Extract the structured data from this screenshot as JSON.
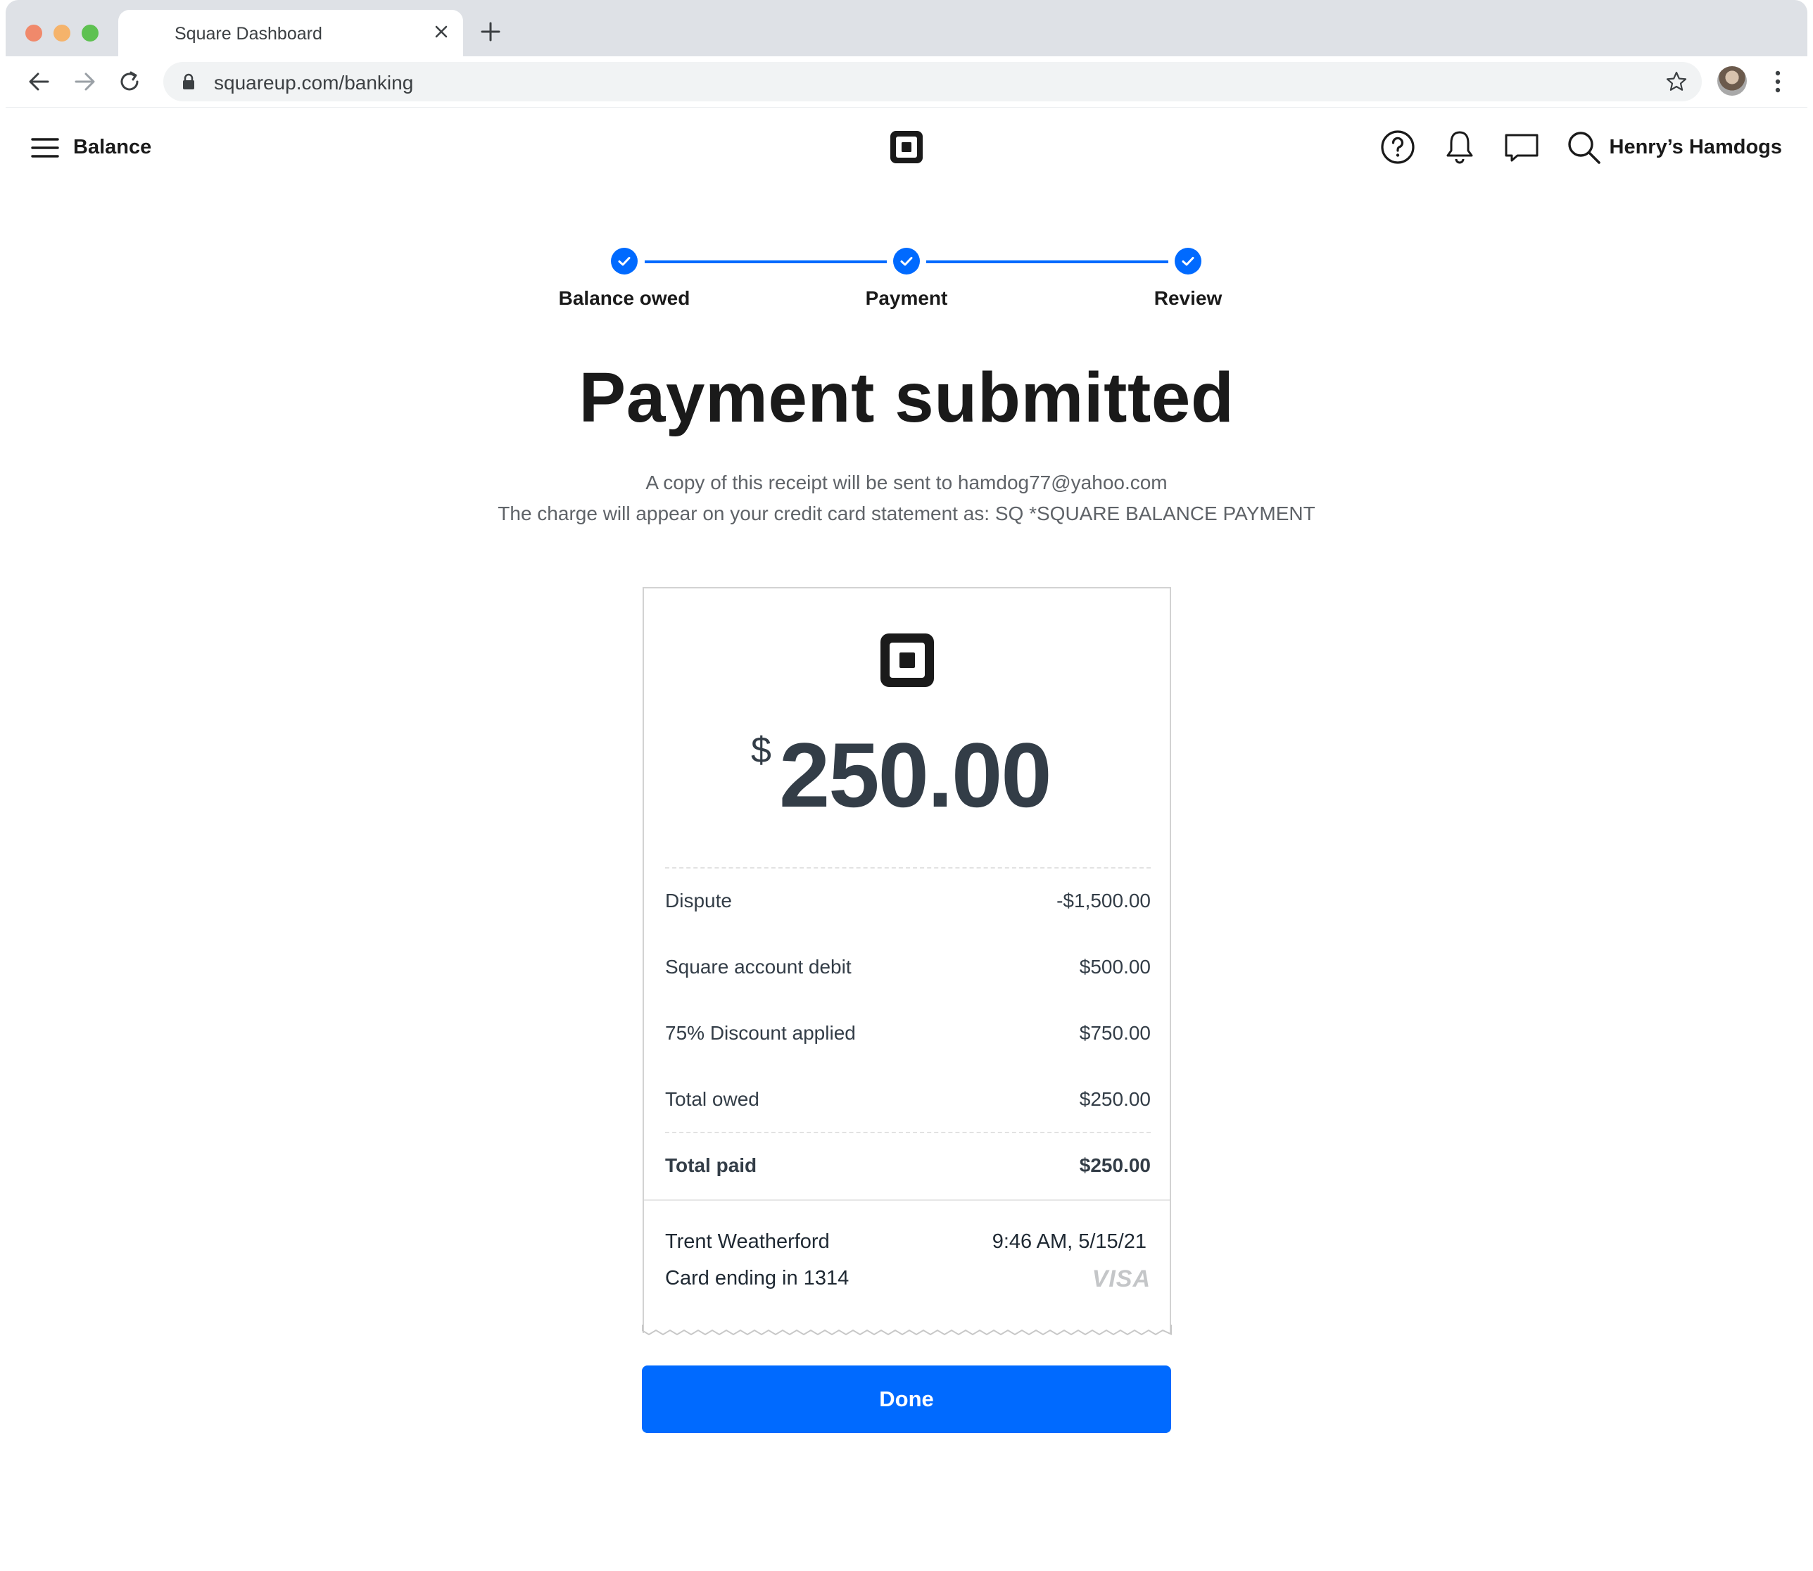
{
  "browser": {
    "tab_title": "Square Dashboard",
    "url": "squareup.com/banking"
  },
  "header": {
    "title": "Balance",
    "merchant_name": "Henry’s Hamdogs"
  },
  "stepper": {
    "steps": [
      {
        "label": "Balance owed",
        "status": "complete"
      },
      {
        "label": "Payment",
        "status": "complete"
      },
      {
        "label": "Review",
        "status": "complete"
      }
    ]
  },
  "main": {
    "title": "Payment submitted",
    "receipt_note": "A copy of this receipt will be sent to hamdog77@yahoo.com",
    "statement_note": "The charge will appear on your credit card statement as: SQ *SQUARE BALANCE PAYMENT"
  },
  "receipt": {
    "currency_symbol": "$",
    "amount": "250.00",
    "line_items": [
      {
        "label": "Dispute",
        "value": "-$1,500.00"
      },
      {
        "label": "Square account debit",
        "value": "$500.00"
      },
      {
        "label": "75% Discount applied",
        "value": "$750.00"
      },
      {
        "label": "Total owed",
        "value": "$250.00"
      }
    ],
    "total": {
      "label": "Total paid",
      "value": "$250.00"
    },
    "payer_name": "Trent Weatherford",
    "timestamp": "9:46 AM, 5/15/21",
    "card": "Card ending in 1314",
    "card_brand": "VISA"
  },
  "actions": {
    "done_label": "Done"
  },
  "colors": {
    "accent": "#006aff",
    "text_primary": "#1a1a1a",
    "text_secondary": "#5f6368",
    "receipt_text": "#333d47"
  }
}
